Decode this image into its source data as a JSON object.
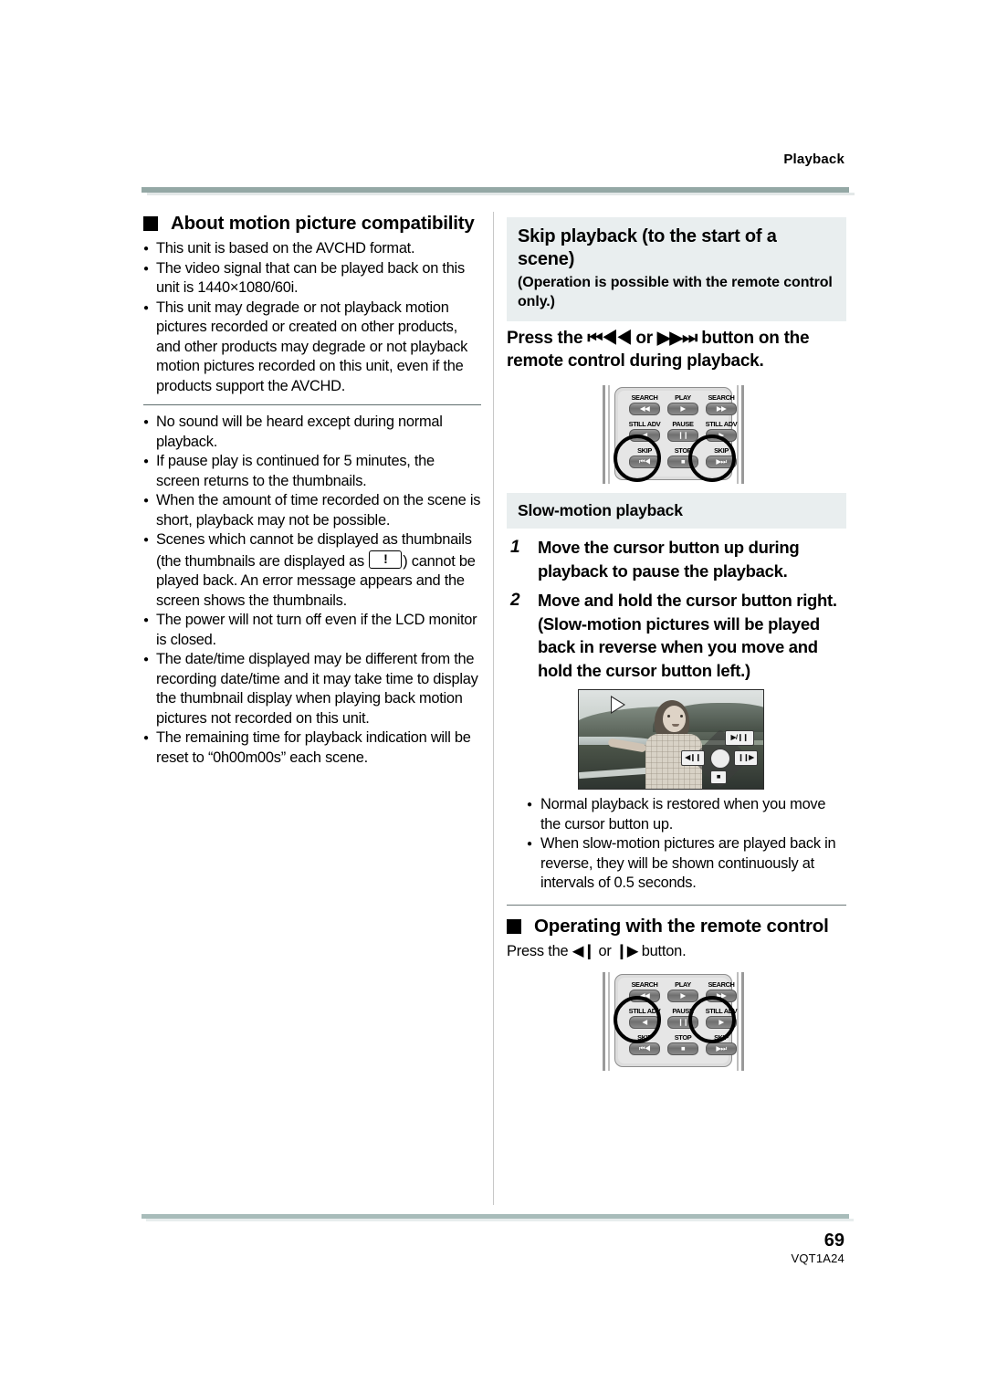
{
  "header": {
    "running_head": "Playback"
  },
  "footer": {
    "page_number": "69",
    "doc_id": "VQT1A24"
  },
  "left_column": {
    "heading": "About motion picture compatibility",
    "bullets_group1": [
      "This unit is based on the AVCHD format.",
      "The video signal that can be played back on this unit is 1440×1080/60i.",
      "This unit may degrade or not playback motion pictures recorded or created on other products, and other products may degrade or not playback motion pictures recorded on this unit, even if the products support the AVCHD."
    ],
    "bullets_group2_a": [
      "No sound will be heard except during normal playback.",
      "If pause play is continued for 5 minutes, the screen returns to the thumbnails.",
      "When the amount of time recorded on the scene is short, playback may not be possible."
    ],
    "scenes_bullet_part1": "Scenes which cannot be displayed as thumbnails (the thumbnails are displayed as",
    "scenes_bullet_part2": ") cannot be played back. An error message appears and the screen shows the thumbnails.",
    "bullets_group2_b": [
      "The power will not turn off even if the LCD monitor is closed.",
      "The date/time displayed may be different from the recording date/time and it may take time to display the thumbnail display when playing back motion pictures not recorded on this unit.",
      "The remaining time for playback indication will be reset to “0h00m00s” each scene."
    ]
  },
  "right_column": {
    "skip_section": {
      "title": "Skip playback (to the start of a scene)",
      "subtitle": "(Operation is possible with the remote control only.)",
      "instruction_part1": "Press the ",
      "instruction_glyph1": "⏮◀◀",
      "instruction_mid": " or ",
      "instruction_glyph2": "▶▶⏭",
      "instruction_part2": " button on the remote control during playback."
    },
    "slow_section": {
      "title": "Slow-motion playback",
      "steps": [
        {
          "num": "1",
          "text": "Move the cursor button up during playback to pause the playback."
        },
        {
          "num": "2",
          "text": "Move and hold the cursor button right. (Slow-motion pictures will be played back in reverse when you move and hold the cursor button left.)"
        }
      ],
      "notes": [
        "Normal playback is restored when you move the cursor button up.",
        "When slow-motion pictures are played back in reverse, they will be shown continuously at intervals of 0.5 seconds."
      ]
    },
    "remote_section": {
      "heading": "Operating with the remote control",
      "instruction_part1": "Press the ",
      "instruction_glyph1": "◀❙",
      "instruction_mid": " or ",
      "instruction_glyph2": "❙▶",
      "instruction_part2": " button."
    }
  },
  "remote_buttons": {
    "search_left_label": "SEARCH",
    "search_left_sym": "◀◀",
    "play_label": "PLAY",
    "play_sym": "▶",
    "search_right_label": "SEARCH",
    "search_right_sym": "▶▶",
    "still_adv_left_label": "STILL ADV",
    "still_adv_left_sym": "◀",
    "pause_label": "PAUSE",
    "pause_sym": "❙❙",
    "still_adv_right_label": "STILL ADV",
    "still_adv_right_sym": "▶",
    "skip_left_label": "SKIP",
    "skip_left_sym": "⏮◀",
    "stop_label": "STOP",
    "stop_sym": "■",
    "skip_right_label": "SKIP",
    "skip_right_sym": "▶⏭"
  },
  "lcd_osd": {
    "play_pause": "▶/❙❙",
    "slow_left": "◀❙❙",
    "slow_right": "❙❙▶",
    "stop": "■"
  },
  "colors": {
    "rule_teal": "#94a8a5",
    "band_bg": "#e9eeef",
    "divider": "#c8c8c8"
  }
}
